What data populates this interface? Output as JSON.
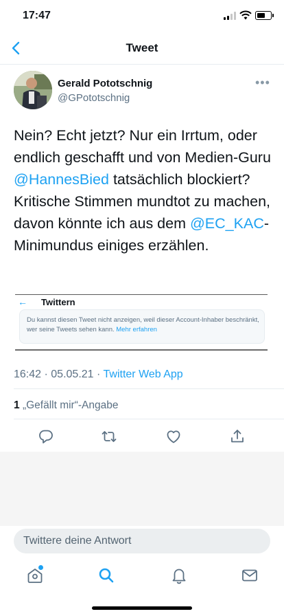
{
  "status_bar": {
    "time": "17:47",
    "battery_level": 0.6
  },
  "header": {
    "title": "Tweet"
  },
  "author": {
    "display_name": "Gerald Pototschnig",
    "handle": "@GPototschnig"
  },
  "tweet": {
    "segments": [
      "Nein? Echt jetzt? Nur ein Irrtum, oder endlich geschafft und von Medien-Guru ",
      "@HannesBied",
      " tatsächlich blockiert? Kritische Stimmen mundtot zu machen, davon könnte ich aus dem ",
      "@EC_KAC",
      "-Minimundus einiges erzählen."
    ],
    "time": "16:42",
    "date": "05.05.21",
    "separator": "·",
    "source": "Twitter Web App"
  },
  "embedded_image": {
    "title": "Twittern",
    "message": "Du kannst diesen Tweet nicht anzeigen, weil dieser Account-Inhaber beschränkt, wer seine Tweets sehen kann.",
    "link": "Mehr erfahren"
  },
  "engagement": {
    "like_count": "1",
    "like_label": "„Gefällt mir“-Angabe"
  },
  "actions": [
    "reply-icon",
    "retweet-icon",
    "like-icon",
    "share-icon"
  ],
  "reply_box": {
    "placeholder": "Twittere deine Antwort"
  },
  "tab_bar": [
    "home-icon",
    "search-icon",
    "notifications-icon",
    "messages-icon"
  ],
  "colors": {
    "accent": "#1da1f2",
    "text": "#0f1419",
    "secondary": "#5b7083"
  }
}
